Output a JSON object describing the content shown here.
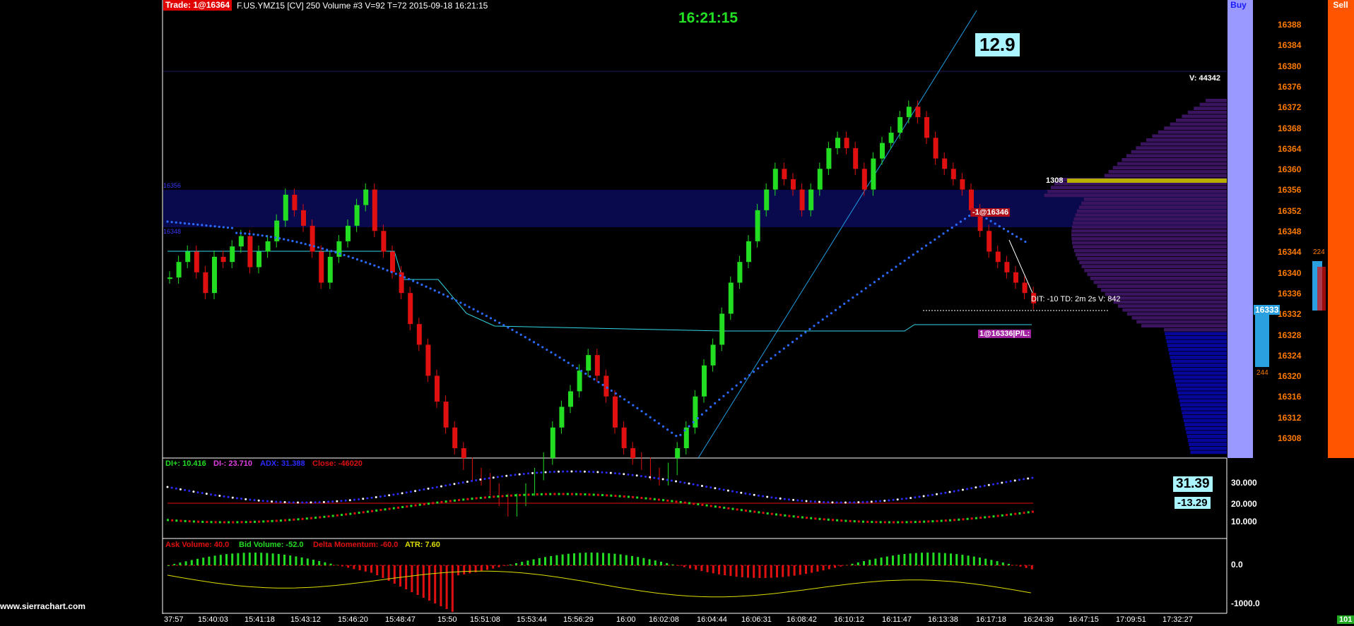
{
  "header": {
    "trade_badge": "Trade: 1@16364",
    "info": "F.US.YMZ15 [CV]  250 Volume  #3 V=92 T=72 2015-09-18 16:21:15",
    "clock": "16:21:15",
    "big_value": "12.9"
  },
  "dom": {
    "buy_label": "Buy",
    "sell_label": "Sell",
    "bid_total": "244",
    "ask_total": "224",
    "current_price": "16333"
  },
  "price_axis": [
    "16388",
    "16384",
    "16380",
    "16376",
    "16372",
    "16368",
    "16364",
    "16360",
    "16356",
    "16352",
    "16348",
    "16344",
    "16340",
    "16336",
    "16332",
    "16328",
    "16324",
    "16320",
    "16316",
    "16312",
    "16308"
  ],
  "chart_labels": {
    "volume_total": "V: 44342",
    "poc_volume": "1308",
    "sell_tag": "-1@16346",
    "position_tag": "1@16336|P/L:",
    "order_info": "DIT: -10  TD: 2m 2s  V: 842",
    "zone_top": "16356",
    "zone_bottom": "16348"
  },
  "indicator1": {
    "di_plus": "DI+: 10.416",
    "di_minus": "DI-: 23.710",
    "adx": "ADX: 31.388",
    "close": "Close: -46020",
    "value_a": "31.39",
    "value_b": "-13.29",
    "axis": [
      "30.000",
      "20.000",
      "10.000"
    ]
  },
  "indicator2": {
    "ask_volume": "Ask Volume: 40.0",
    "bid_volume": "Bid Volume: -52.0",
    "delta_momentum": "Delta Momentum: -60.0",
    "atr": "ATR: 7.60",
    "axis": [
      "0.0",
      "-1000.0"
    ]
  },
  "time_axis": [
    "37:57",
    "15:40:03",
    "15:41:18",
    "15:43:12",
    "15:46:20",
    "15:48:47",
    "15:50",
    "15:51:08",
    "15:53:44",
    "15:56:29",
    "16:00",
    "16:02:08",
    "16:04:44",
    "16:06:31",
    "16:08:42",
    "16:10:12",
    "16:11:47",
    "16:13:38",
    "16:17:18",
    "16:24:39",
    "16:47:15",
    "17:09:51",
    "17:32:27"
  ],
  "corner_value": "101",
  "watermark": "www.sierrachart.com",
  "colors": {
    "up_candle": "#22dd22",
    "down_candle": "#e01010",
    "price_label": "#ff7a00",
    "clock": "#22e022",
    "buy_column": "#9999ff",
    "sell_column": "#ff5500",
    "volume_profile_top": "#3a145e",
    "volume_profile_bottom": "#06069a",
    "poc_line": "#b8b000",
    "stop_line": "#33d6e6",
    "trend_line": "#1e9ee6",
    "big_value_bg": "#aaf5ff"
  }
}
